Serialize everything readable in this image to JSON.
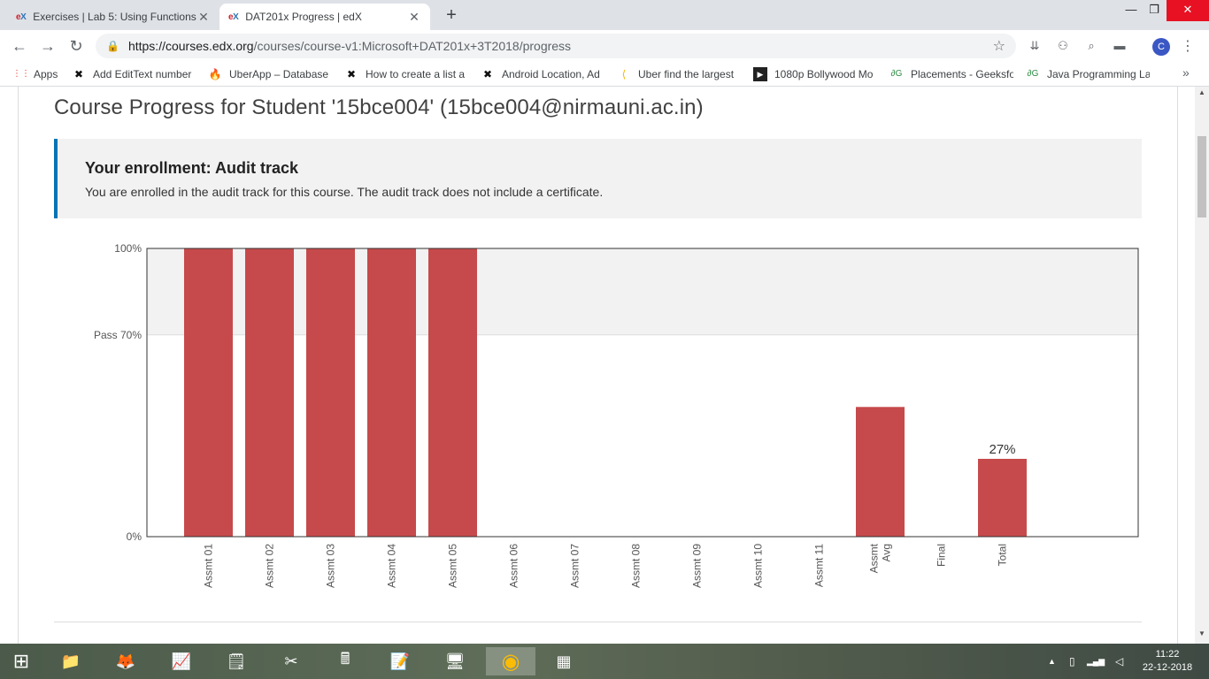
{
  "browser": {
    "tabs": [
      {
        "title": "Exercises | Lab 5: Using Functions",
        "active": false
      },
      {
        "title": "DAT201x Progress | edX",
        "active": true
      }
    ],
    "favicon_e": "e",
    "favicon_x": "X",
    "close_glyph": "✕",
    "newtab_glyph": "+",
    "window": {
      "min": "—",
      "max": "❐",
      "close": "✕"
    },
    "nav": {
      "back": "←",
      "forward": "→",
      "reload": "↻"
    },
    "url_host": "https://courses.edx.org",
    "url_path": "/courses/course-v1:Microsoft+DAT201x+3T2018/progress",
    "lock_glyph": "🔒",
    "star_glyph": "☆",
    "profile_initial": "C",
    "menu_glyph": "⋮",
    "extensions": [
      "⇊",
      "⚇",
      "⌕",
      "▬"
    ],
    "bookmarks": [
      {
        "label": "Apps",
        "icon": "apps-grid-icon",
        "glyph": "⋮⋮"
      },
      {
        "label": "Add EditText number",
        "icon": "x-logo-icon",
        "glyph": "✖"
      },
      {
        "label": "UberApp – Database",
        "icon": "firebase-icon",
        "glyph": "🔥"
      },
      {
        "label": "How to create a list a",
        "icon": "x-logo-icon",
        "glyph": "✖"
      },
      {
        "label": "Android Location, Ad",
        "icon": "x-logo-icon",
        "glyph": "✖"
      },
      {
        "label": "Uber find the largest",
        "icon": "arrow-logo-icon",
        "glyph": "⟨"
      },
      {
        "label": "1080p Bollywood Mo",
        "icon": "play-icon",
        "glyph": "▶"
      },
      {
        "label": "Placements - Geeksfo",
        "icon": "gfg-icon",
        "glyph": "∂G"
      },
      {
        "label": "Java Programming La",
        "icon": "gfg-icon",
        "glyph": "∂G"
      }
    ],
    "bookmarks_more": "»"
  },
  "page": {
    "title": "Course Progress for Student '15bce004' (15bce004@nirmauni.ac.in)",
    "enrollment": {
      "title": "Your enrollment: Audit track",
      "text": "You are enrolled in the audit track for this course. The audit track does not include a certificate."
    }
  },
  "chart_data": {
    "type": "bar",
    "categories": [
      "Assmt 01",
      "Assmt 02",
      "Assmt 03",
      "Assmt 04",
      "Assmt 05",
      "Assmt 06",
      "Assmt 07",
      "Assmt 08",
      "Assmt 09",
      "Assmt 10",
      "Assmt 11",
      "Assmt Avg",
      "Final",
      "Total"
    ],
    "category_lines": [
      [
        "Assmt 01"
      ],
      [
        "Assmt 02"
      ],
      [
        "Assmt 03"
      ],
      [
        "Assmt 04"
      ],
      [
        "Assmt 05"
      ],
      [
        "Assmt 06"
      ],
      [
        "Assmt 07"
      ],
      [
        "Assmt 08"
      ],
      [
        "Assmt 09"
      ],
      [
        "Assmt 10"
      ],
      [
        "Assmt 11"
      ],
      [
        "Assmt",
        "Avg"
      ],
      [
        "Final"
      ],
      [
        "Total"
      ]
    ],
    "values": [
      100,
      100,
      100,
      100,
      100,
      0,
      0,
      0,
      0,
      0,
      0,
      45,
      0,
      27
    ],
    "ylim": [
      0,
      100
    ],
    "y_ticks": [
      {
        "value": 0,
        "label": "0%"
      },
      {
        "value": 70,
        "label": "Pass 70%"
      },
      {
        "value": 100,
        "label": "100%"
      }
    ],
    "pass_threshold": 70,
    "total_label": "27%",
    "bar_color": "#c64a4b",
    "pass_band_color": "#f2f2f2"
  },
  "taskbar": {
    "start_glyph": "⊞",
    "apps": [
      {
        "name": "file-explorer",
        "glyph": "📁"
      },
      {
        "name": "firefox",
        "glyph": "🦊"
      },
      {
        "name": "performance-monitor",
        "glyph": "📈"
      },
      {
        "name": "sticky-notes",
        "glyph": "🗒"
      },
      {
        "name": "snipping-tool",
        "glyph": "✂"
      },
      {
        "name": "calculator",
        "glyph": "🖩"
      },
      {
        "name": "notepad",
        "glyph": "📝"
      },
      {
        "name": "control-panel",
        "glyph": "🖥"
      },
      {
        "name": "chrome",
        "glyph": "◉"
      },
      {
        "name": "network-app",
        "glyph": "▦"
      }
    ],
    "tray_up": "▲",
    "tray_icons": [
      "▯",
      "▂▄▆",
      "◁"
    ],
    "time": "11:22",
    "date": "22-12-2018"
  }
}
